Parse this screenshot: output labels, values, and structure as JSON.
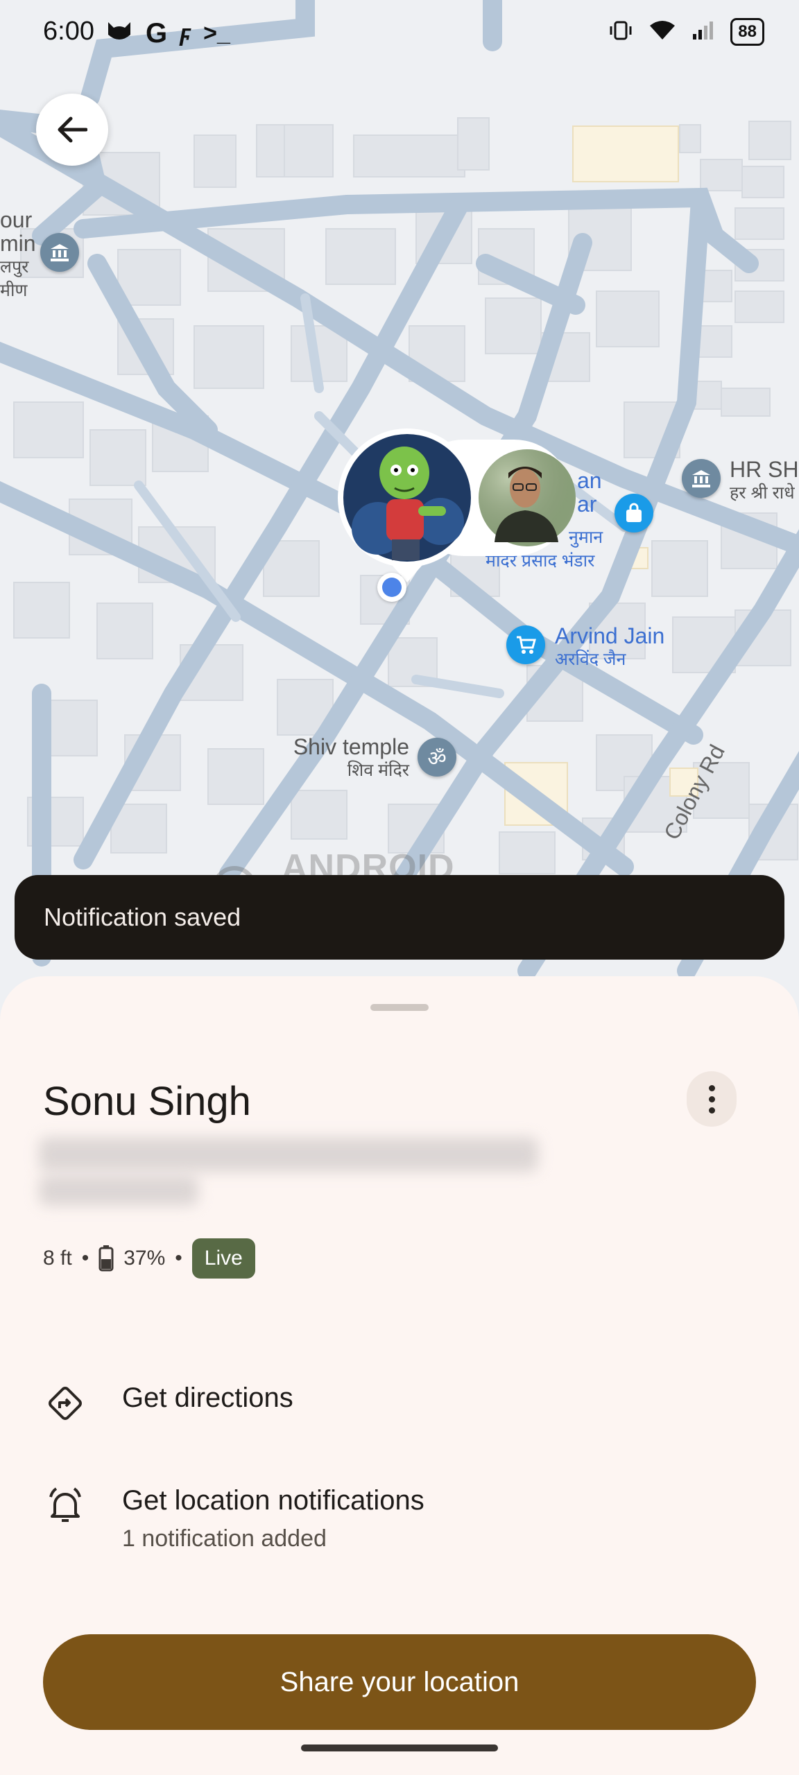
{
  "status_bar": {
    "time": "6:00",
    "battery": "88",
    "icons": [
      "cat-icon",
      "google-g-icon",
      "flash-icon",
      "terminal-icon",
      "vibrate-icon",
      "wifi-icon",
      "signal-icon",
      "battery-icon"
    ]
  },
  "map": {
    "places": [
      {
        "name": "HR SH",
        "sub": "हर श्री राधे"
      },
      {
        "name": "Arvind Jain",
        "sub": "अरविंद जैन"
      },
      {
        "name": "Shiv temple",
        "sub": "शिव मंदिर"
      },
      {
        "name": "an",
        "name2": "ar",
        "sub": "नुमान",
        "sub2": "मादर प्रसाद भंडार"
      },
      {
        "name": "our",
        "name2": "min",
        "sub": "लपुर",
        "sub2": "मीण"
      }
    ],
    "road": "Colony Rd",
    "watermark": "ANDROID AUTHORITY"
  },
  "snackbar": {
    "message": "Notification saved"
  },
  "sheet": {
    "person_name": "Sonu Singh",
    "distance": "8 ft",
    "battery": "37%",
    "live_label": "Live",
    "actions": [
      {
        "label": "Get directions",
        "icon": "directions-icon"
      },
      {
        "label": "Get location notifications",
        "sublabel": "1 notification added",
        "icon": "bell-icon"
      }
    ],
    "share_button": "Share your location"
  },
  "colors": {
    "accent": "#7c5417",
    "live_badge": "#586a45",
    "map_label": "#3b6fd1",
    "sheet_bg": "#fdf5f2"
  }
}
